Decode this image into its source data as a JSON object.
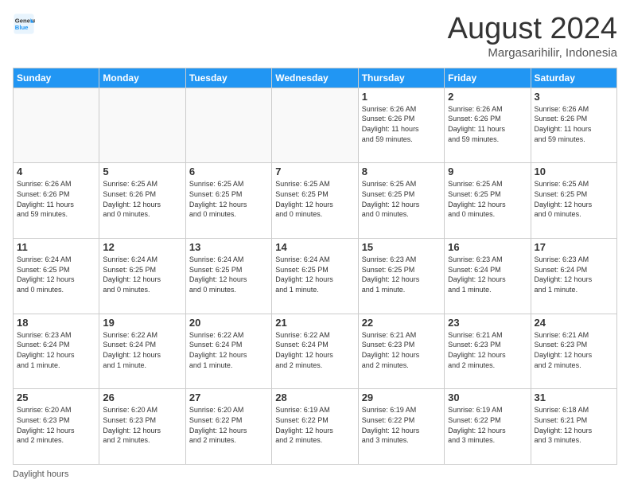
{
  "logo": {
    "line1": "General",
    "line2": "Blue"
  },
  "title": "August 2024",
  "location": "Margasarihilir, Indonesia",
  "days_of_week": [
    "Sunday",
    "Monday",
    "Tuesday",
    "Wednesday",
    "Thursday",
    "Friday",
    "Saturday"
  ],
  "footer": "Daylight hours",
  "weeks": [
    [
      {
        "day": "",
        "info": ""
      },
      {
        "day": "",
        "info": ""
      },
      {
        "day": "",
        "info": ""
      },
      {
        "day": "",
        "info": ""
      },
      {
        "day": "1",
        "info": "Sunrise: 6:26 AM\nSunset: 6:26 PM\nDaylight: 11 hours\nand 59 minutes."
      },
      {
        "day": "2",
        "info": "Sunrise: 6:26 AM\nSunset: 6:26 PM\nDaylight: 11 hours\nand 59 minutes."
      },
      {
        "day": "3",
        "info": "Sunrise: 6:26 AM\nSunset: 6:26 PM\nDaylight: 11 hours\nand 59 minutes."
      }
    ],
    [
      {
        "day": "4",
        "info": "Sunrise: 6:26 AM\nSunset: 6:26 PM\nDaylight: 11 hours\nand 59 minutes."
      },
      {
        "day": "5",
        "info": "Sunrise: 6:25 AM\nSunset: 6:26 PM\nDaylight: 12 hours\nand 0 minutes."
      },
      {
        "day": "6",
        "info": "Sunrise: 6:25 AM\nSunset: 6:25 PM\nDaylight: 12 hours\nand 0 minutes."
      },
      {
        "day": "7",
        "info": "Sunrise: 6:25 AM\nSunset: 6:25 PM\nDaylight: 12 hours\nand 0 minutes."
      },
      {
        "day": "8",
        "info": "Sunrise: 6:25 AM\nSunset: 6:25 PM\nDaylight: 12 hours\nand 0 minutes."
      },
      {
        "day": "9",
        "info": "Sunrise: 6:25 AM\nSunset: 6:25 PM\nDaylight: 12 hours\nand 0 minutes."
      },
      {
        "day": "10",
        "info": "Sunrise: 6:25 AM\nSunset: 6:25 PM\nDaylight: 12 hours\nand 0 minutes."
      }
    ],
    [
      {
        "day": "11",
        "info": "Sunrise: 6:24 AM\nSunset: 6:25 PM\nDaylight: 12 hours\nand 0 minutes."
      },
      {
        "day": "12",
        "info": "Sunrise: 6:24 AM\nSunset: 6:25 PM\nDaylight: 12 hours\nand 0 minutes."
      },
      {
        "day": "13",
        "info": "Sunrise: 6:24 AM\nSunset: 6:25 PM\nDaylight: 12 hours\nand 0 minutes."
      },
      {
        "day": "14",
        "info": "Sunrise: 6:24 AM\nSunset: 6:25 PM\nDaylight: 12 hours\nand 1 minute."
      },
      {
        "day": "15",
        "info": "Sunrise: 6:23 AM\nSunset: 6:25 PM\nDaylight: 12 hours\nand 1 minute."
      },
      {
        "day": "16",
        "info": "Sunrise: 6:23 AM\nSunset: 6:24 PM\nDaylight: 12 hours\nand 1 minute."
      },
      {
        "day": "17",
        "info": "Sunrise: 6:23 AM\nSunset: 6:24 PM\nDaylight: 12 hours\nand 1 minute."
      }
    ],
    [
      {
        "day": "18",
        "info": "Sunrise: 6:23 AM\nSunset: 6:24 PM\nDaylight: 12 hours\nand 1 minute."
      },
      {
        "day": "19",
        "info": "Sunrise: 6:22 AM\nSunset: 6:24 PM\nDaylight: 12 hours\nand 1 minute."
      },
      {
        "day": "20",
        "info": "Sunrise: 6:22 AM\nSunset: 6:24 PM\nDaylight: 12 hours\nand 1 minute."
      },
      {
        "day": "21",
        "info": "Sunrise: 6:22 AM\nSunset: 6:24 PM\nDaylight: 12 hours\nand 2 minutes."
      },
      {
        "day": "22",
        "info": "Sunrise: 6:21 AM\nSunset: 6:23 PM\nDaylight: 12 hours\nand 2 minutes."
      },
      {
        "day": "23",
        "info": "Sunrise: 6:21 AM\nSunset: 6:23 PM\nDaylight: 12 hours\nand 2 minutes."
      },
      {
        "day": "24",
        "info": "Sunrise: 6:21 AM\nSunset: 6:23 PM\nDaylight: 12 hours\nand 2 minutes."
      }
    ],
    [
      {
        "day": "25",
        "info": "Sunrise: 6:20 AM\nSunset: 6:23 PM\nDaylight: 12 hours\nand 2 minutes."
      },
      {
        "day": "26",
        "info": "Sunrise: 6:20 AM\nSunset: 6:23 PM\nDaylight: 12 hours\nand 2 minutes."
      },
      {
        "day": "27",
        "info": "Sunrise: 6:20 AM\nSunset: 6:22 PM\nDaylight: 12 hours\nand 2 minutes."
      },
      {
        "day": "28",
        "info": "Sunrise: 6:19 AM\nSunset: 6:22 PM\nDaylight: 12 hours\nand 2 minutes."
      },
      {
        "day": "29",
        "info": "Sunrise: 6:19 AM\nSunset: 6:22 PM\nDaylight: 12 hours\nand 3 minutes."
      },
      {
        "day": "30",
        "info": "Sunrise: 6:19 AM\nSunset: 6:22 PM\nDaylight: 12 hours\nand 3 minutes."
      },
      {
        "day": "31",
        "info": "Sunrise: 6:18 AM\nSunset: 6:21 PM\nDaylight: 12 hours\nand 3 minutes."
      }
    ]
  ]
}
